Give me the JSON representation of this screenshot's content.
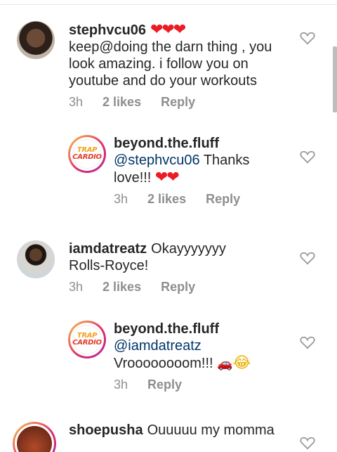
{
  "comments": [
    {
      "username": "stephvcu06",
      "hearts": "❤❤❤",
      "text_lines": [
        "keep@doing the darn thing , you",
        "look amazing. i follow you on",
        "youtube and do your workouts"
      ],
      "time": "3h",
      "likes": "2 likes",
      "reply": "Reply"
    },
    {
      "username": "beyond.the.fluff",
      "mention": "@stephvcu06",
      "text_after_mention": "Thanks",
      "line2": "love!!!",
      "hearts": "❤❤",
      "time": "3h",
      "likes": "2 likes",
      "reply": "Reply"
    },
    {
      "username": "iamdatreatz",
      "text_first": "Okayyyyyyy",
      "line2": "Rolls-Royce!",
      "time": "3h",
      "likes": "2 likes",
      "reply": "Reply"
    },
    {
      "username": "beyond.the.fluff",
      "mention": "@iamdatreatz",
      "line2": "Vroooooooom!!!",
      "car_emoji": "🚗",
      "laugh_emoji": "😂",
      "time": "3h",
      "reply": "Reply"
    },
    {
      "username": "shoepusha",
      "text_first": "Ouuuuu my momma"
    }
  ],
  "logo": {
    "line1": "TRAP",
    "line2": "CARDIO"
  }
}
